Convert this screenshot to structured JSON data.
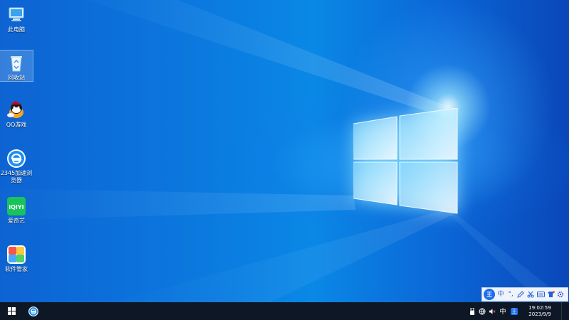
{
  "desktop_icons": [
    {
      "label": "此电脑",
      "icon": "computer-icon"
    },
    {
      "label": "回收站",
      "icon": "recycle-bin-icon"
    },
    {
      "label": "QQ游戏",
      "icon": "qq-game-icon"
    },
    {
      "label": "2345加速浏\n览器",
      "icon": "browser-2345-icon"
    },
    {
      "label": "爱奇艺",
      "icon": "iqiyi-icon"
    },
    {
      "label": "软件管家",
      "icon": "software-manager-icon"
    }
  ],
  "iqiyi_logo_text": "iQIYI",
  "ime_bar": {
    "logo_text": "王",
    "mode": "中",
    "punctuation": "°,",
    "items": [
      "pen-icon",
      "scissors-icon",
      "keyboard-icon",
      "skin-icon",
      "gear-icon"
    ]
  },
  "taskbar": {
    "pinned": [
      "browser-2345-icon"
    ],
    "tray": {
      "language": "中",
      "ime_logo": "王",
      "time": "19:02:59",
      "date": "2023/9/9"
    }
  },
  "colors": {
    "wallpaper_blue": "#0b79df",
    "taskbar": "#0e1725",
    "ime_blue": "#1e6df0"
  }
}
